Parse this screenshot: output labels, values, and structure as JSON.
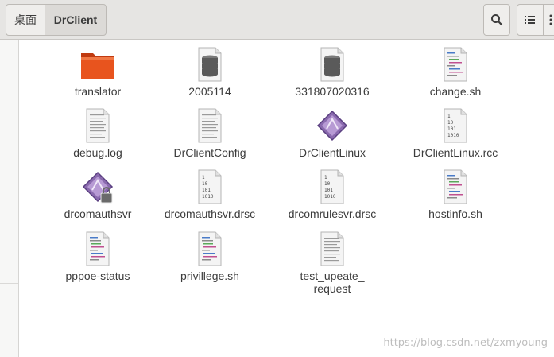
{
  "breadcrumb": {
    "home": "桌面",
    "current": "DrClient"
  },
  "toolbar": {
    "search_icon": "search-icon",
    "view_icon": "list-view-icon",
    "menu_icon": "more-icon"
  },
  "files": [
    {
      "name": "translator",
      "type": "folder"
    },
    {
      "name": "2005114",
      "type": "database"
    },
    {
      "name": "331807020316",
      "type": "database"
    },
    {
      "name": "change.sh",
      "type": "script"
    },
    {
      "name": "debug.log",
      "type": "text"
    },
    {
      "name": "DrClientConfig",
      "type": "text"
    },
    {
      "name": "DrClientLinux",
      "type": "executable"
    },
    {
      "name": "DrClientLinux.rcc",
      "type": "binary"
    },
    {
      "name": "drcomauthsvr",
      "type": "executable-locked"
    },
    {
      "name": "drcomauthsvr.drsc",
      "type": "binary"
    },
    {
      "name": "drcomrulesvr.drsc",
      "type": "binary"
    },
    {
      "name": "hostinfo.sh",
      "type": "script"
    },
    {
      "name": "pppoe-status",
      "type": "script"
    },
    {
      "name": "privillege.sh",
      "type": "script"
    },
    {
      "name": "test_upeate_\nrequest",
      "type": "text"
    }
  ],
  "watermark": "https://blog.csdn.net/zxmyoung",
  "colors": {
    "folder": "#e8541e",
    "header_bg": "#e6e5e3"
  }
}
